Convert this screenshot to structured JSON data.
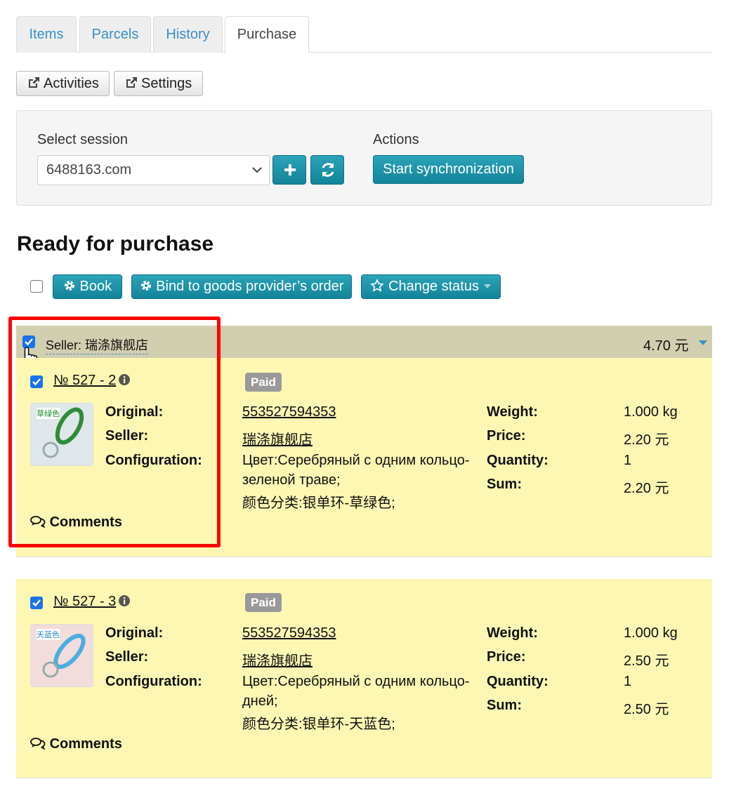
{
  "tabs": [
    {
      "label": "Items"
    },
    {
      "label": "Parcels"
    },
    {
      "label": "History"
    },
    {
      "label": "Purchase"
    }
  ],
  "toolbar": {
    "activities": "Activities",
    "settings": "Settings"
  },
  "session": {
    "select_label": "Select session",
    "selected": "6488163.com",
    "actions_label": "Actions",
    "sync_button": "Start synchronization"
  },
  "section_title": "Ready for purchase",
  "bulk_actions": {
    "book": "Book",
    "bind": "Bind to goods provider’s order",
    "change_status": "Change status"
  },
  "seller_group": {
    "seller_label": "Seller: 瑞涤旗舰店",
    "total": "4.70 元"
  },
  "labels": {
    "original": "Original:",
    "seller": "Seller:",
    "configuration": "Configuration:",
    "weight": "Weight:",
    "price": "Price:",
    "quantity": "Quantity:",
    "sum": "Sum:",
    "comments": "Comments"
  },
  "items": [
    {
      "number": "№ 527 - 2",
      "status": "Paid",
      "thumb_caption": "草绿色",
      "thumb_color": "#2e8b3a",
      "original": "553527594353",
      "seller": "瑞涤旗舰店",
      "config_line1": "Цвет:Серебряный с одним кольцо-",
      "config_line2": "зеленой траве;",
      "config_line3": "颜色分类:银单环-草绿色;",
      "weight": "1.000 kg",
      "price": "2.20 元",
      "quantity": "1",
      "sum": "2.20 元"
    },
    {
      "number": "№ 527 - 3",
      "status": "Paid",
      "thumb_caption": "天蓝色",
      "thumb_color": "#4aaee0",
      "original": "553527594353",
      "seller": "瑞涤旗舰店",
      "config_line1": "Цвет:Серебряный с одним кольцо-",
      "config_line2": "дней;",
      "config_line3": "颜色分类:银单环-天蓝色;",
      "weight": "1.000 kg",
      "price": "2.50 元",
      "quantity": "1",
      "sum": "2.50 元"
    }
  ],
  "colors": {
    "accent": "#1891a6",
    "link": "#3a8fc8",
    "card_bg": "#fdf7b3",
    "seller_bar": "#d2ceb0",
    "highlight": "#ff0000"
  }
}
